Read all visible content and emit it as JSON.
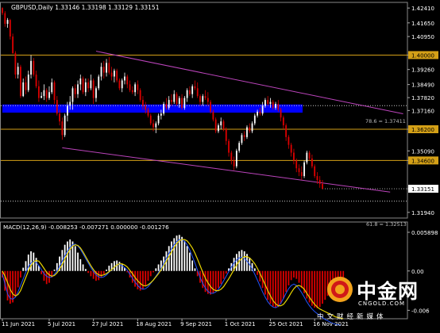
{
  "header": {
    "symbol_line": "GBPUSD,Daily  1.33146 1.33198 1.33129 1.33151"
  },
  "macd": {
    "label": "MACD(12,26,9) -0.008253 -0.007271 0.000000 -0.001276",
    "axis_ticks": [
      "0.005898",
      "0.00",
      "-0.006"
    ]
  },
  "levels": {
    "fib_upper_label": "78.6 = 1.37411",
    "fib_lower_label": "61.8 = 1.32513"
  },
  "watermark": {
    "title": "中金网",
    "url": "CNGOLD.COM",
    "slogan": "中文财经新媒体"
  },
  "colors": {
    "background": "#000000",
    "bull_candle": "#ffffff",
    "bear_candle": "#dd0000",
    "channel": "#bb44bb",
    "level_line": "#d4a017",
    "zone": "#0000ff",
    "macd_signal": "#e8d400",
    "macd_line": "#2255ff",
    "price_tag_bg": "#ffffff"
  },
  "chart_data": {
    "type": "candlestick",
    "symbol": "GBPUSD",
    "timeframe": "Daily",
    "price_axis_ticks": [
      1.4241,
      1.4165,
      1.4095,
      1.4,
      1.3926,
      1.3849,
      1.3782,
      1.3716,
      1.362,
      1.3509,
      1.346,
      1.3315,
      1.3194
    ],
    "y_axis_labels": [
      "1.42410",
      "1.41650",
      "1.40950",
      "1.40000",
      "1.39260",
      "1.38490",
      "1.37820",
      "1.37160",
      "1.36200",
      "1.35090",
      "1.34600",
      "1.33151",
      "1.31940"
    ],
    "current_price": "1.33151",
    "horizontal_levels": [
      {
        "price": 1.4,
        "label": "1.40000"
      },
      {
        "price": 1.362,
        "label": "1.36200"
      },
      {
        "price": 1.346,
        "label": "1.34600"
      }
    ],
    "fib_levels": [
      {
        "price": 1.37411,
        "label": "78.6 = 1.37411"
      },
      {
        "price": 1.32513,
        "label": "61.8 = 1.32513"
      }
    ],
    "resistance_zone": {
      "from": 1.3705,
      "to": 1.3747
    },
    "x_axis_labels": [
      "11 Jun 2021",
      "5 Jul 2021",
      "27 Jul 2021",
      "18 Aug 2021",
      "9 Sep 2021",
      "1 Oct 2021",
      "25 Oct 2021",
      "16 Nov 2021"
    ],
    "channel": {
      "upper": [
        {
          "i": 40,
          "p": 1.4009
        },
        {
          "i": 157,
          "p": 1.3691
        }
      ],
      "lower": [
        {
          "i": 23,
          "p": 1.3525
        },
        {
          "i": 149,
          "p": 1.3298
        }
      ]
    },
    "ohlc": [
      [
        1.4241,
        1.4245,
        1.4205,
        1.4215
      ],
      [
        1.4215,
        1.4225,
        1.4145,
        1.416
      ],
      [
        1.416,
        1.419,
        1.414,
        1.418
      ],
      [
        1.418,
        1.4186,
        1.408,
        1.4095
      ],
      [
        1.4095,
        1.411,
        1.4005,
        1.401
      ],
      [
        1.401,
        1.402,
        1.388,
        1.39
      ],
      [
        1.39,
        1.396,
        1.388,
        1.394
      ],
      [
        1.394,
        1.395,
        1.378,
        1.379
      ],
      [
        1.379,
        1.388,
        1.3785,
        1.386
      ],
      [
        1.386,
        1.389,
        1.38,
        1.382
      ],
      [
        1.382,
        1.392,
        1.381,
        1.39
      ],
      [
        1.39,
        1.4,
        1.388,
        1.397
      ],
      [
        1.397,
        1.3985,
        1.389,
        1.39
      ],
      [
        1.39,
        1.392,
        1.383,
        1.384
      ],
      [
        1.384,
        1.387,
        1.376,
        1.378
      ],
      [
        1.378,
        1.381,
        1.378,
        1.379
      ],
      [
        1.379,
        1.385,
        1.377,
        1.382
      ],
      [
        1.382,
        1.383,
        1.376,
        1.378
      ],
      [
        1.378,
        1.384,
        1.377,
        1.381
      ],
      [
        1.381,
        1.388,
        1.38,
        1.386
      ],
      [
        1.386,
        1.387,
        1.375,
        1.377
      ],
      [
        1.377,
        1.379,
        1.369,
        1.37
      ],
      [
        1.37,
        1.372,
        1.364,
        1.366
      ],
      [
        1.366,
        1.368,
        1.3566,
        1.359
      ],
      [
        1.359,
        1.37,
        1.358,
        1.369
      ],
      [
        1.369,
        1.376,
        1.366,
        1.374
      ],
      [
        1.374,
        1.379,
        1.372,
        1.376
      ],
      [
        1.376,
        1.384,
        1.372,
        1.383
      ],
      [
        1.383,
        1.385,
        1.378,
        1.38
      ],
      [
        1.38,
        1.387,
        1.378,
        1.385
      ],
      [
        1.385,
        1.39,
        1.382,
        1.388
      ],
      [
        1.388,
        1.389,
        1.38,
        1.381
      ],
      [
        1.381,
        1.388,
        1.379,
        1.386
      ],
      [
        1.386,
        1.388,
        1.381,
        1.383
      ],
      [
        1.383,
        1.39,
        1.382,
        1.387
      ],
      [
        1.387,
        1.388,
        1.375,
        1.378
      ],
      [
        1.378,
        1.384,
        1.376,
        1.383
      ],
      [
        1.383,
        1.39,
        1.382,
        1.389
      ],
      [
        1.389,
        1.396,
        1.387,
        1.394
      ],
      [
        1.394,
        1.397,
        1.388,
        1.391
      ],
      [
        1.391,
        1.398,
        1.389,
        1.396
      ],
      [
        1.396,
        1.399,
        1.39,
        1.391
      ],
      [
        1.391,
        1.394,
        1.387,
        1.389
      ],
      [
        1.389,
        1.393,
        1.386,
        1.392
      ],
      [
        1.392,
        1.393,
        1.386,
        1.387
      ],
      [
        1.387,
        1.388,
        1.382,
        1.383
      ],
      [
        1.383,
        1.388,
        1.381,
        1.387
      ],
      [
        1.387,
        1.391,
        1.385,
        1.389
      ],
      [
        1.389,
        1.39,
        1.383,
        1.385
      ],
      [
        1.385,
        1.387,
        1.381,
        1.382
      ],
      [
        1.382,
        1.384,
        1.38,
        1.381
      ],
      [
        1.381,
        1.386,
        1.379,
        1.385
      ],
      [
        1.385,
        1.387,
        1.38,
        1.382
      ],
      [
        1.382,
        1.383,
        1.376,
        1.377
      ],
      [
        1.377,
        1.379,
        1.372,
        1.374
      ],
      [
        1.374,
        1.376,
        1.37,
        1.372
      ],
      [
        1.372,
        1.373,
        1.368,
        1.369
      ],
      [
        1.369,
        1.37,
        1.364,
        1.365
      ],
      [
        1.365,
        1.367,
        1.361,
        1.363
      ],
      [
        1.363,
        1.366,
        1.36,
        1.365
      ],
      [
        1.365,
        1.37,
        1.364,
        1.369
      ],
      [
        1.369,
        1.372,
        1.367,
        1.37
      ],
      [
        1.37,
        1.376,
        1.369,
        1.375
      ],
      [
        1.375,
        1.378,
        1.372,
        1.373
      ],
      [
        1.373,
        1.379,
        1.372,
        1.377
      ],
      [
        1.377,
        1.38,
        1.374,
        1.376
      ],
      [
        1.376,
        1.382,
        1.375,
        1.38
      ],
      [
        1.38,
        1.381,
        1.374,
        1.375
      ],
      [
        1.375,
        1.379,
        1.373,
        1.378
      ],
      [
        1.378,
        1.38,
        1.372,
        1.373
      ],
      [
        1.373,
        1.379,
        1.372,
        1.378
      ],
      [
        1.378,
        1.383,
        1.376,
        1.382
      ],
      [
        1.382,
        1.384,
        1.379,
        1.38
      ],
      [
        1.38,
        1.385,
        1.378,
        1.384
      ],
      [
        1.384,
        1.387,
        1.382,
        1.383
      ],
      [
        1.383,
        1.386,
        1.378,
        1.379
      ],
      [
        1.379,
        1.38,
        1.374,
        1.376
      ],
      [
        1.376,
        1.38,
        1.374,
        1.379
      ],
      [
        1.379,
        1.382,
        1.377,
        1.378
      ],
      [
        1.378,
        1.381,
        1.374,
        1.376
      ],
      [
        1.376,
        1.377,
        1.37,
        1.371
      ],
      [
        1.371,
        1.372,
        1.366,
        1.367
      ],
      [
        1.367,
        1.368,
        1.36,
        1.361
      ],
      [
        1.361,
        1.365,
        1.36,
        1.364
      ],
      [
        1.364,
        1.368,
        1.362,
        1.366
      ],
      [
        1.366,
        1.367,
        1.361,
        1.362
      ],
      [
        1.362,
        1.363,
        1.354,
        1.356
      ],
      [
        1.356,
        1.357,
        1.348,
        1.35
      ],
      [
        1.35,
        1.351,
        1.344,
        1.346
      ],
      [
        1.346,
        1.348,
        1.3411,
        1.343
      ],
      [
        1.343,
        1.352,
        1.342,
        1.351
      ],
      [
        1.351,
        1.356,
        1.35,
        1.355
      ],
      [
        1.355,
        1.36,
        1.354,
        1.359
      ],
      [
        1.359,
        1.361,
        1.356,
        1.358
      ],
      [
        1.358,
        1.364,
        1.357,
        1.363
      ],
      [
        1.363,
        1.365,
        1.36,
        1.361
      ],
      [
        1.361,
        1.366,
        1.36,
        1.365
      ],
      [
        1.365,
        1.37,
        1.364,
        1.369
      ],
      [
        1.369,
        1.372,
        1.368,
        1.371
      ],
      [
        1.371,
        1.373,
        1.369,
        1.37
      ],
      [
        1.37,
        1.376,
        1.369,
        1.374
      ],
      [
        1.374,
        1.378,
        1.373,
        1.377
      ],
      [
        1.377,
        1.379,
        1.374,
        1.375
      ],
      [
        1.375,
        1.378,
        1.373,
        1.376
      ],
      [
        1.376,
        1.377,
        1.372,
        1.373
      ],
      [
        1.373,
        1.376,
        1.372,
        1.375
      ],
      [
        1.375,
        1.377,
        1.371,
        1.372
      ],
      [
        1.372,
        1.373,
        1.366,
        1.368
      ],
      [
        1.368,
        1.369,
        1.362,
        1.364
      ],
      [
        1.364,
        1.365,
        1.356,
        1.358
      ],
      [
        1.358,
        1.359,
        1.352,
        1.354
      ],
      [
        1.354,
        1.355,
        1.348,
        1.35
      ],
      [
        1.35,
        1.352,
        1.344,
        1.346
      ],
      [
        1.346,
        1.347,
        1.34,
        1.342
      ],
      [
        1.342,
        1.344,
        1.338,
        1.34
      ],
      [
        1.34,
        1.343,
        1.336,
        1.338
      ],
      [
        1.338,
        1.346,
        1.337,
        1.345
      ],
      [
        1.345,
        1.351,
        1.344,
        1.35
      ],
      [
        1.35,
        1.351,
        1.346,
        1.347
      ],
      [
        1.347,
        1.349,
        1.342,
        1.343
      ],
      [
        1.343,
        1.344,
        1.337,
        1.338
      ],
      [
        1.338,
        1.34,
        1.334,
        1.336
      ],
      [
        1.336,
        1.338,
        1.332,
        1.334
      ],
      [
        1.334,
        1.336,
        1.3313,
        1.3315
      ]
    ],
    "macd": {
      "label": "MACD(12,26,9) -0.008253 -0.007271 0.000000 -0.001276",
      "axis_ticks": [
        0.005898,
        0.0,
        -0.006
      ],
      "histogram": [
        -0.001,
        -0.003,
        -0.0045,
        -0.005,
        -0.0048,
        -0.004,
        -0.0025,
        -0.001,
        0.0005,
        0.0015,
        0.0025,
        0.003,
        0.0028,
        0.002,
        0.0008,
        -0.0005,
        -0.0015,
        -0.002,
        -0.0018,
        -0.001,
        0.0002,
        0.0012,
        0.0022,
        0.0032,
        0.004,
        0.0045,
        0.0048,
        0.0045,
        0.0038,
        0.0028,
        0.0018,
        0.001,
        0.0003,
        -0.0003,
        -0.0008,
        -0.0012,
        -0.0015,
        -0.0014,
        -0.001,
        -0.0005,
        0.0002,
        0.0008,
        0.0012,
        0.0015,
        0.0016,
        0.0014,
        0.001,
        0.0005,
        -0.0002,
        -0.001,
        -0.0018,
        -0.0024,
        -0.0028,
        -0.003,
        -0.0028,
        -0.0022,
        -0.0015,
        -0.0008,
        -0.0002,
        0.0004,
        0.001,
        0.0016,
        0.0022,
        0.003,
        0.0038,
        0.0045,
        0.005,
        0.0054,
        0.0055,
        0.0052,
        0.0046,
        0.0038,
        0.0028,
        0.0016,
        0.0004,
        -0.0008,
        -0.0018,
        -0.0026,
        -0.0032,
        -0.0035,
        -0.0036,
        -0.0034,
        -0.003,
        -0.0026,
        -0.002,
        -0.0012,
        -0.0004,
        0.0004,
        0.0012,
        0.002,
        0.0026,
        0.003,
        0.0032,
        0.003,
        0.0026,
        0.002,
        0.0012,
        0.0004,
        -0.0006,
        -0.0016,
        -0.0026,
        -0.0036,
        -0.0044,
        -0.005,
        -0.0054,
        -0.0056,
        -0.0055,
        -0.005,
        -0.0042,
        -0.0032,
        -0.0022,
        -0.0014,
        -0.001,
        -0.0012,
        -0.0018,
        -0.0026,
        -0.0034,
        -0.0042,
        -0.0048,
        -0.0053,
        -0.0056,
        -0.0057,
        -0.0055,
        -0.005,
        -0.0044,
        -0.0038,
        -0.0032,
        -0.0028,
        -0.0026,
        -0.0025,
        -0.0024,
        -0.0024
      ],
      "signal": [
        0.0,
        -0.0008,
        -0.0018,
        -0.0028,
        -0.0035,
        -0.0038,
        -0.0036,
        -0.003,
        -0.002,
        -0.001,
        0.0,
        0.0008,
        0.0014,
        0.0016,
        0.0015,
        0.001,
        0.0004,
        -0.0002,
        -0.0006,
        -0.0008,
        -0.0007,
        -0.0003,
        0.0003,
        0.001,
        0.0018,
        0.0026,
        0.0033,
        0.0038,
        0.004,
        0.0039,
        0.0035,
        0.0029,
        0.0022,
        0.0015,
        0.0008,
        0.0002,
        -0.0003,
        -0.0006,
        -0.0007,
        -0.0006,
        -0.0004,
        -0.0001,
        0.0002,
        0.0006,
        0.0009,
        0.0011,
        0.0011,
        0.0009,
        0.0006,
        0.0001,
        -0.0004,
        -0.001,
        -0.0015,
        -0.0019,
        -0.0022,
        -0.0023,
        -0.0021,
        -0.0018,
        -0.0014,
        -0.0009,
        -0.0004,
        0.0002,
        0.0008,
        0.0015,
        0.0022,
        0.0029,
        0.0036,
        0.0042,
        0.0046,
        0.0048,
        0.0048,
        0.0046,
        0.0041,
        0.0035,
        0.0027,
        0.0018,
        0.0008,
        -0.0002,
        -0.0011,
        -0.0018,
        -0.0024,
        -0.0028,
        -0.003,
        -0.003,
        -0.0028,
        -0.0024,
        -0.0018,
        -0.0012,
        -0.0005,
        0.0002,
        0.0009,
        0.0015,
        0.0019,
        0.0022,
        0.0022,
        0.002,
        0.0016,
        0.0011,
        0.0004,
        -0.0004,
        -0.0012,
        -0.0021,
        -0.003,
        -0.0038,
        -0.0045,
        -0.005,
        -0.0053,
        -0.0053,
        -0.0051,
        -0.0046,
        -0.004,
        -0.0033,
        -0.0027,
        -0.0023,
        -0.0022,
        -0.0024,
        -0.0028,
        -0.0034,
        -0.004,
        -0.0046,
        -0.0051,
        -0.0055,
        -0.0058,
        -0.006,
        -0.0062,
        -0.0064,
        -0.0066,
        -0.0068,
        -0.007,
        -0.0071,
        -0.0072,
        -0.0073
      ],
      "line": [
        -0.0005,
        -0.002,
        -0.0035,
        -0.0042,
        -0.0043,
        -0.004,
        -0.0032,
        -0.0022,
        -0.0012,
        -0.0002,
        0.0007,
        0.0012,
        0.0015,
        0.0013,
        0.0008,
        0.0002,
        -0.0004,
        -0.0008,
        -0.001,
        -0.0009,
        -0.0005,
        0.0,
        0.0007,
        0.0015,
        0.0023,
        0.003,
        0.0036,
        0.004,
        0.0041,
        0.0038,
        0.0033,
        0.0026,
        0.0019,
        0.0012,
        0.0005,
        -0.0001,
        -0.0006,
        -0.0009,
        -0.001,
        -0.0009,
        -0.0006,
        -0.0002,
        0.0002,
        0.0006,
        0.0009,
        0.001,
        0.0008,
        0.0005,
        0.0001,
        -0.0005,
        -0.0011,
        -0.0017,
        -0.0022,
        -0.0026,
        -0.0028,
        -0.0027,
        -0.0024,
        -0.0019,
        -0.0014,
        -0.0008,
        -0.0002,
        0.0004,
        0.0011,
        0.0019,
        0.0027,
        0.0034,
        0.004,
        0.0045,
        0.0048,
        0.0048,
        0.0045,
        0.004,
        0.0032,
        0.0022,
        0.0012,
        0.0001,
        -0.001,
        -0.0019,
        -0.0026,
        -0.0031,
        -0.0034,
        -0.0034,
        -0.0032,
        -0.0028,
        -0.0022,
        -0.0015,
        -0.0008,
        -0.0001,
        0.0006,
        0.0012,
        0.0017,
        0.002,
        0.0021,
        0.0019,
        0.0015,
        0.001,
        0.0003,
        -0.0005,
        -0.0014,
        -0.0023,
        -0.0032,
        -0.004,
        -0.0047,
        -0.0052,
        -0.0055,
        -0.0056,
        -0.0054,
        -0.0049,
        -0.0042,
        -0.0034,
        -0.0027,
        -0.0022,
        -0.002,
        -0.0022,
        -0.0027,
        -0.0033,
        -0.004,
        -0.0047,
        -0.0053,
        -0.0058,
        -0.0062,
        -0.0065,
        -0.0068,
        -0.0071,
        -0.0074,
        -0.0076,
        -0.0078,
        -0.008,
        -0.0081,
        -0.0082,
        -0.00825
      ]
    }
  }
}
